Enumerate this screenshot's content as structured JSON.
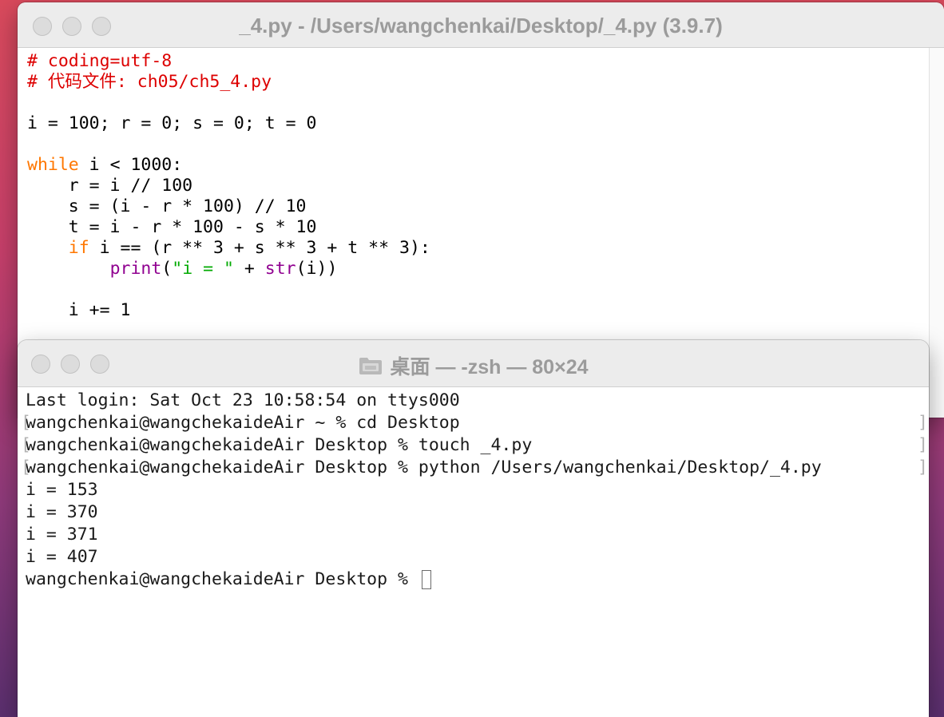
{
  "editor": {
    "title": "_4.py - /Users/wangchenkai/Desktop/_4.py (3.9.7)",
    "code": {
      "l1": "# coding=utf-8",
      "l2": "# 代码文件: ch05/ch5_4.py",
      "l4": "i = 100; r = 0; s = 0; t = 0",
      "l6_kw": "while",
      "l6_rest": " i < 1000:",
      "l7": "    r = i // 100",
      "l8": "    s = (i - r * 100) // 10",
      "l9": "    t = i - r * 100 - s * 10",
      "l10_indent": "    ",
      "l10_kw": "if",
      "l10_rest": " i == (r ** 3 + s ** 3 + t ** 3):",
      "l11_indent": "        ",
      "l11_fn": "print",
      "l11_p1": "(",
      "l11_str": "\"i = \"",
      "l11_p2": " + ",
      "l11_bi": "str",
      "l11_p3": "(i))",
      "l13": "    i += 1"
    }
  },
  "terminal": {
    "title": "桌面 — -zsh — 80×24",
    "lines": [
      "Last login: Sat Oct 23 10:58:54 on ttys000",
      "wangchenkai@wangchekaideAir ~ % cd Desktop",
      "wangchenkai@wangchekaideAir Desktop % touch _4.py",
      "wangchenkai@wangchekaideAir Desktop % python /Users/wangchenkai/Desktop/_4.py",
      "i = 153",
      "i = 370",
      "i = 371",
      "i = 407",
      "wangchenkai@wangchekaideAir Desktop % "
    ],
    "bracket_open": "[",
    "bracket_close": "]"
  }
}
